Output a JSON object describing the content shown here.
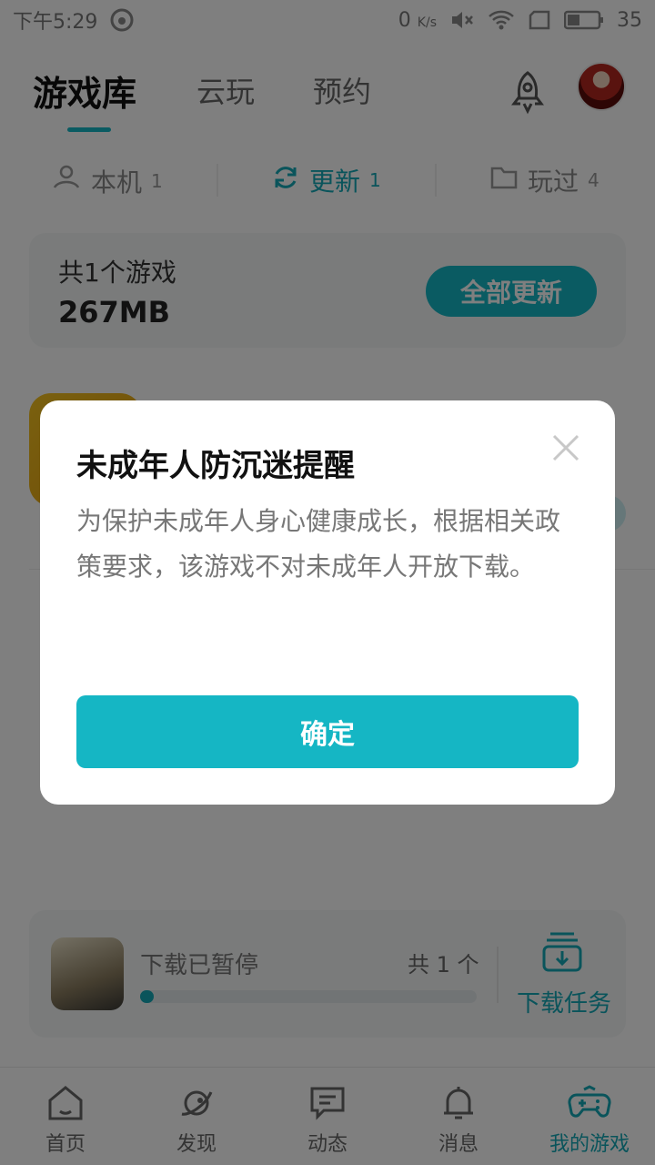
{
  "status_bar": {
    "time": "下午5:29",
    "net_speed_value": "0",
    "net_speed_unit": "K/s",
    "battery": "35"
  },
  "header": {
    "tabs": [
      {
        "label": "游戏库",
        "active": true
      },
      {
        "label": "云玩",
        "active": false
      },
      {
        "label": "预约",
        "active": false
      }
    ]
  },
  "subtabs": [
    {
      "label": "本机",
      "count": "1",
      "active": false
    },
    {
      "label": "更新",
      "count": "1",
      "active": true
    },
    {
      "label": "玩过",
      "count": "4",
      "active": false
    }
  ],
  "summary": {
    "count_text": "共1个游戏",
    "size_text": "267MB",
    "update_all_label": "全部更新"
  },
  "download_panel": {
    "status_text": "下载已暂停",
    "total_text": "共 1 个",
    "task_label": "下载任务",
    "progress": 0.02
  },
  "bottom_nav": [
    {
      "label": "首页",
      "icon": "home-icon",
      "active": false
    },
    {
      "label": "发现",
      "icon": "planet-icon",
      "active": false
    },
    {
      "label": "动态",
      "icon": "chat-icon",
      "active": false
    },
    {
      "label": "消息",
      "icon": "bell-icon",
      "active": false
    },
    {
      "label": "我的游戏",
      "icon": "gamepad-icon",
      "active": true
    }
  ],
  "modal": {
    "title": "未成年人防沉迷提醒",
    "body": "为保护未成年人身心健康成长，根据相关政策要求，该游戏不对未成年人开放下载。",
    "confirm_label": "确定"
  },
  "colors": {
    "accent": "#15b6c4"
  }
}
